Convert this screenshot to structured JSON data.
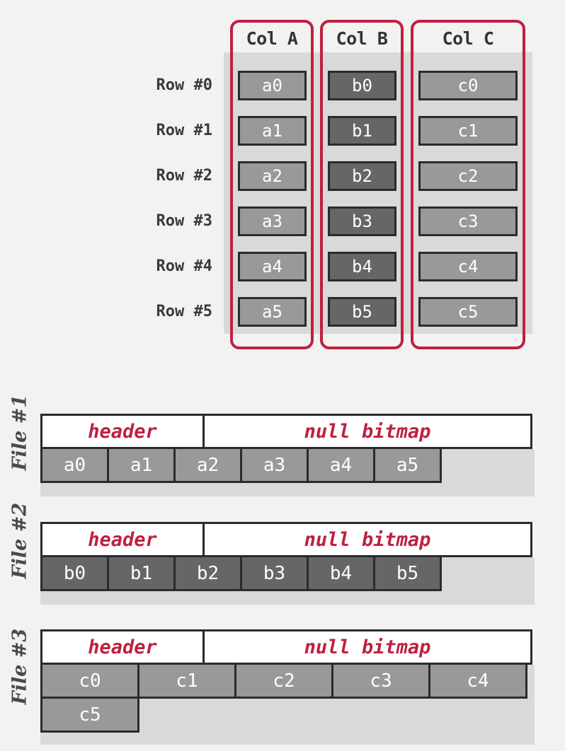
{
  "table": {
    "columns": [
      {
        "label": "Col A",
        "key": "a",
        "shade": "light"
      },
      {
        "label": "Col B",
        "key": "b",
        "shade": "dark"
      },
      {
        "label": "Col C",
        "key": "c",
        "shade": "light"
      }
    ],
    "row_labels": [
      "Row #0",
      "Row #1",
      "Row #2",
      "Row #3",
      "Row #4",
      "Row #5"
    ],
    "cells": {
      "a": [
        "a0",
        "a1",
        "a2",
        "a3",
        "a4",
        "a5"
      ],
      "b": [
        "b0",
        "b1",
        "b2",
        "b3",
        "b4",
        "b5"
      ],
      "c": [
        "c0",
        "c1",
        "c2",
        "c3",
        "c4",
        "c5"
      ]
    }
  },
  "files": [
    {
      "label": "File #1",
      "header_left": "header",
      "header_right": "null bitmap",
      "values_row1": [
        "a0",
        "a1",
        "a2",
        "a3",
        "a4",
        "a5"
      ],
      "values_row2": []
    },
    {
      "label": "File #2",
      "header_left": "header",
      "header_right": "null bitmap",
      "values_row1": [
        "b0",
        "b1",
        "b2",
        "b3",
        "b4",
        "b5"
      ],
      "values_row2": []
    },
    {
      "label": "File #3",
      "header_left": "header",
      "header_right": "null bitmap",
      "values_row1": [
        "c0",
        "c1",
        "c2",
        "c3",
        "c4"
      ],
      "values_row2": [
        "c5"
      ]
    }
  ],
  "colors": {
    "accent_red": "#bf2040",
    "page_bg": "#f2f2f0",
    "band_bg": "#d9d9d9",
    "cell_light": "#999999",
    "cell_dark": "#666666",
    "border": "#2b2b2b"
  }
}
